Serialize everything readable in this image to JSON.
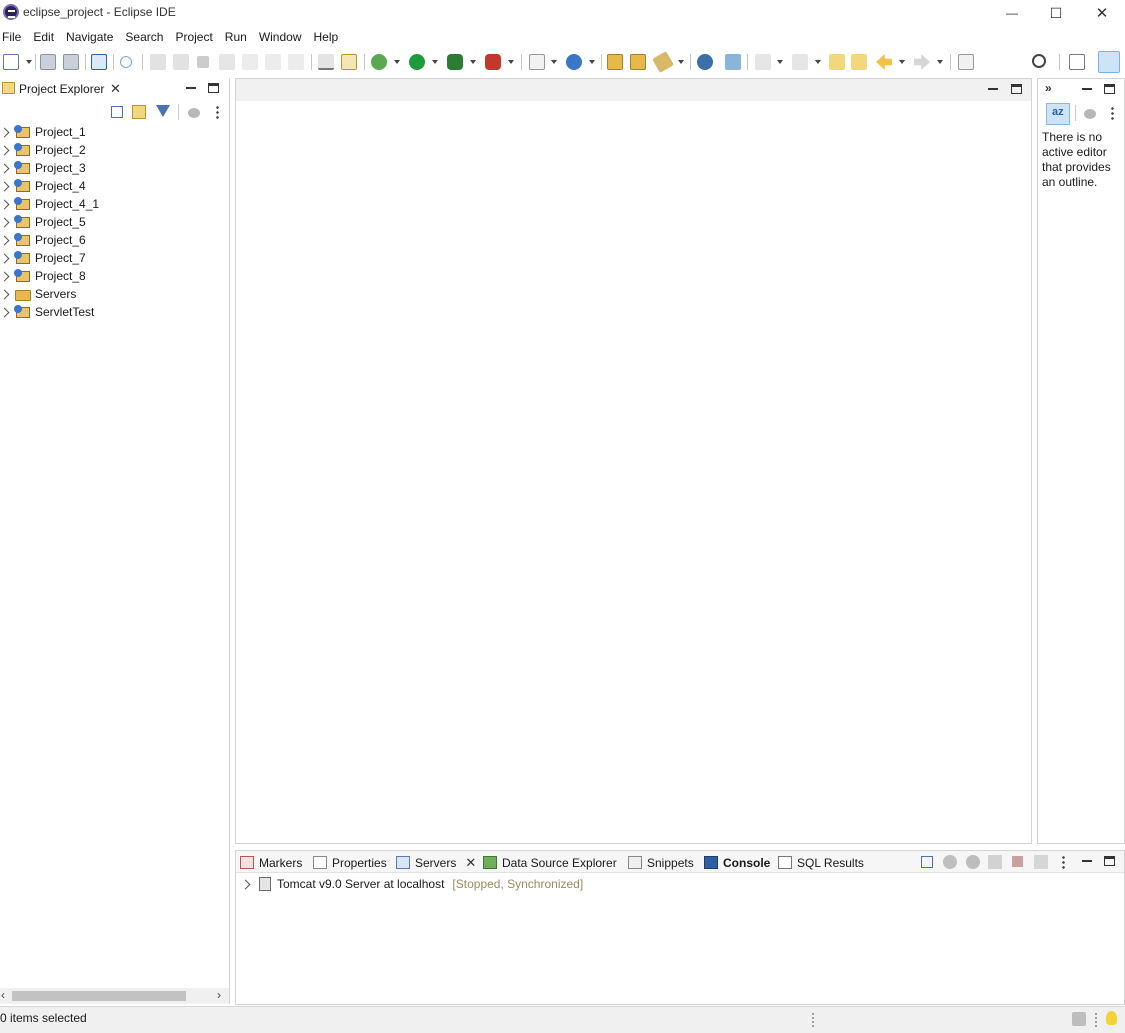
{
  "window": {
    "title": "eclipse_project - Eclipse IDE",
    "minimize_glyph": "—",
    "maximize_glyph": "☐",
    "close_glyph": "✕"
  },
  "menubar": {
    "items": [
      "File",
      "Edit",
      "Navigate",
      "Search",
      "Project",
      "Run",
      "Window",
      "Help"
    ]
  },
  "explorer": {
    "title": "Project Explorer",
    "items": [
      {
        "label": "Project_1",
        "icon": "web-project-icon"
      },
      {
        "label": "Project_2",
        "icon": "web-project-icon"
      },
      {
        "label": "Project_3",
        "icon": "web-project-icon"
      },
      {
        "label": "Project_4",
        "icon": "web-project-icon"
      },
      {
        "label": "Project_4_1",
        "icon": "web-project-icon"
      },
      {
        "label": "Project_5",
        "icon": "web-project-icon"
      },
      {
        "label": "Project_6",
        "icon": "web-project-icon"
      },
      {
        "label": "Project_7",
        "icon": "web-project-icon"
      },
      {
        "label": "Project_8",
        "icon": "web-project-icon"
      },
      {
        "label": "Servers",
        "icon": "folder-icon"
      },
      {
        "label": "ServletTest",
        "icon": "web-project-icon"
      }
    ]
  },
  "outline": {
    "message": "There is no active editor that provides an outline."
  },
  "bottom": {
    "tabs": [
      {
        "label": "Markers",
        "icon": "markers-icon",
        "bold": false
      },
      {
        "label": "Properties",
        "icon": "properties-icon",
        "bold": false
      },
      {
        "label": "Servers",
        "icon": "servers-icon",
        "bold": false,
        "active": true
      },
      {
        "label": "Data Source Explorer",
        "icon": "data-source-icon",
        "bold": false
      },
      {
        "label": "Snippets",
        "icon": "snippets-icon",
        "bold": false
      },
      {
        "label": "Console",
        "icon": "console-icon",
        "bold": true
      },
      {
        "label": "SQL Results",
        "icon": "sql-results-icon",
        "bold": false
      }
    ],
    "server": {
      "name": "Tomcat v9.0 Server at localhost",
      "status": "[Stopped, Synchronized]"
    }
  },
  "statusbar": {
    "text": "0 items selected"
  },
  "colors": {
    "status_text": "#9a8a5a",
    "accent": "#3a77c7",
    "run_green": "#1e9b3a",
    "folder_yellow": "#e7b94b"
  }
}
